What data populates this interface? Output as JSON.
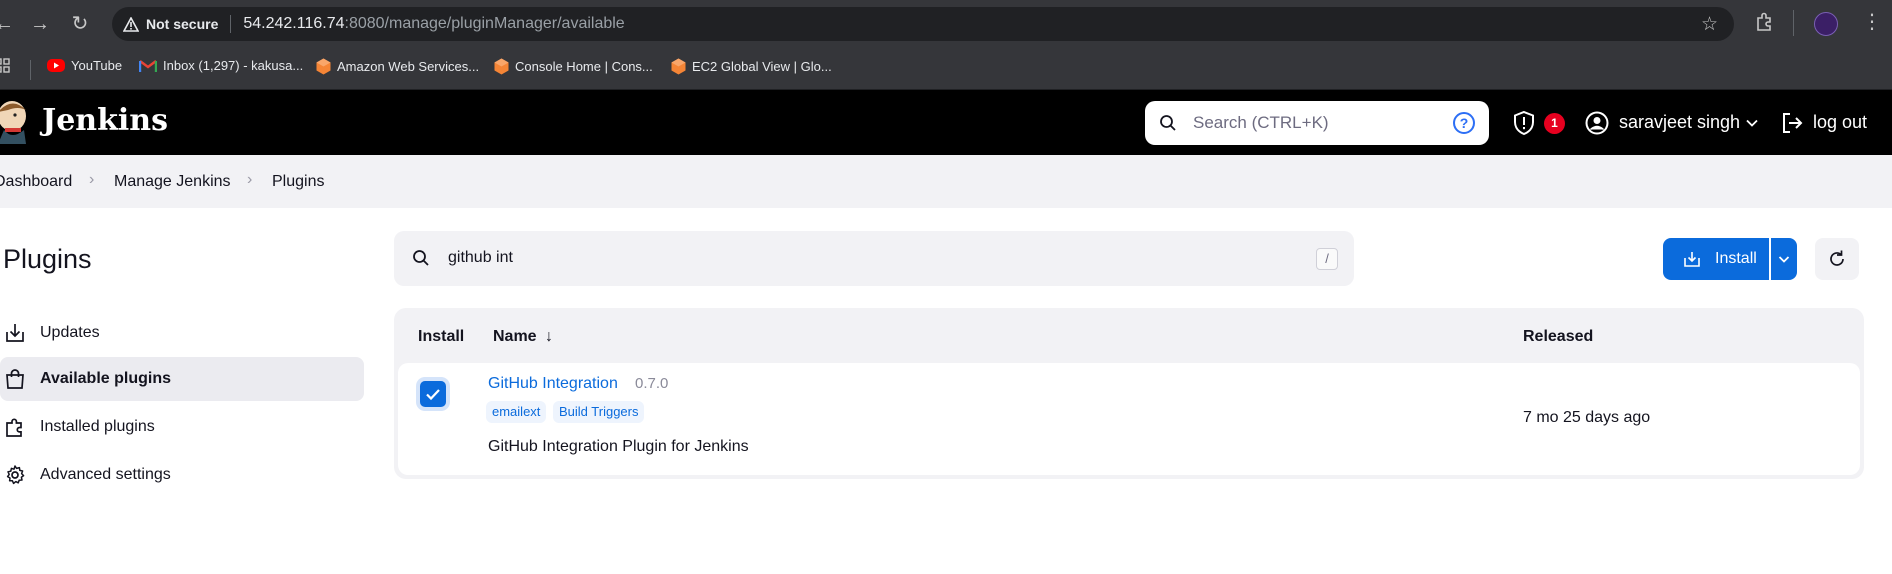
{
  "browser": {
    "not_secure": "Not secure",
    "url_host": "54.242.116.74",
    "url_path": ":8080/manage/pluginManager/available",
    "bookmarks": [
      {
        "label": "YouTube",
        "icon": "youtube-icon",
        "color": "#ff0000"
      },
      {
        "label": "Inbox (1,297) - kakusa...",
        "icon": "gmail-icon",
        "color": "#ea4335"
      },
      {
        "label": "Amazon Web Services...",
        "icon": "aws-icon",
        "color": "#f58536"
      },
      {
        "label": "Console Home | Cons...",
        "icon": "aws-icon",
        "color": "#f58536"
      },
      {
        "label": "EC2 Global View | Glo...",
        "icon": "aws-icon",
        "color": "#f58536"
      }
    ]
  },
  "header": {
    "brand": "Jenkins",
    "search_placeholder": "Search (CTRL+K)",
    "security_count": "1",
    "user": "saravjeet singh",
    "logout": "log out"
  },
  "breadcrumbs": [
    "Dashboard",
    "Manage Jenkins",
    "Plugins"
  ],
  "sidebar": {
    "title": "Plugins",
    "items": [
      {
        "label": "Updates",
        "icon": "download-icon",
        "active": false
      },
      {
        "label": "Available plugins",
        "icon": "shopping-bag-icon",
        "active": true
      },
      {
        "label": "Installed plugins",
        "icon": "puzzle-icon",
        "active": false
      },
      {
        "label": "Advanced settings",
        "icon": "gear-icon",
        "active": false
      }
    ]
  },
  "filter": {
    "value": "github int",
    "shortcut": "/"
  },
  "actions": {
    "install": "Install"
  },
  "table": {
    "headers": {
      "install": "Install",
      "name": "Name",
      "sort": "↓",
      "released": "Released"
    },
    "rows": [
      {
        "checked": true,
        "name": "GitHub Integration",
        "version": "0.7.0",
        "tags": [
          "emailext",
          "Build Triggers"
        ],
        "description": "GitHub Integration Plugin for Jenkins",
        "released": "7 mo 25 days ago"
      }
    ]
  },
  "colors": {
    "accent": "#0b6bdc",
    "header_bg": "#000000",
    "badge": "#e6001f"
  }
}
